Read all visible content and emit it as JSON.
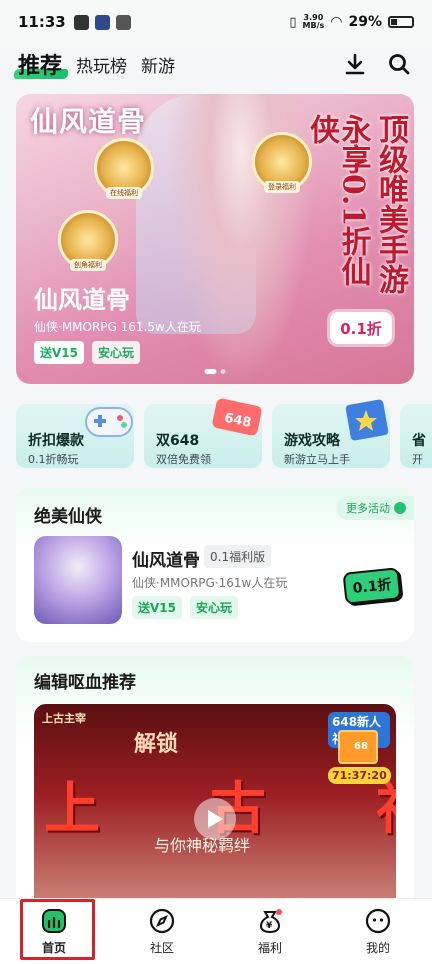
{
  "status_bar": {
    "time": "11:33",
    "net_speed_value": "3.90",
    "net_speed_unit": "MB/s",
    "battery": "29%"
  },
  "top_nav": {
    "tabs": [
      {
        "label": "推荐",
        "active": true
      },
      {
        "label": "热玩榜",
        "active": false
      },
      {
        "label": "新游",
        "active": false
      }
    ],
    "icons": [
      "download-icon",
      "search-icon"
    ]
  },
  "banner": {
    "logo_text": "仙风道骨",
    "medals": [
      "在线福利",
      "登录福利",
      "创角福利"
    ],
    "slogan_cols": [
      "顶级唯美手游",
      "永享0.1折仙侠"
    ],
    "title": "仙风道骨",
    "meta": "仙侠·MMORPG  161.5w人在玩",
    "tags": [
      "送V15",
      "安心玩"
    ],
    "discount": "0.1折"
  },
  "quick_entries": [
    {
      "title": "折扣爆款",
      "subtitle": "0.1折畅玩",
      "icon": "gamepad-icon"
    },
    {
      "title": "双648",
      "subtitle": "双倍免费领",
      "icon": "coupon-648-icon",
      "icon_text": "648"
    },
    {
      "title": "游戏攻略",
      "subtitle": "新游立马上手",
      "icon": "guide-book-icon"
    },
    {
      "title": "省",
      "subtitle": "开",
      "icon": "partial-icon"
    }
  ],
  "featured_section": {
    "title": "绝美仙侠",
    "more_label": "更多活动",
    "game": {
      "name": "仙风道骨",
      "version": "0.1福利版",
      "meta": "仙侠·MMORPG·161w人在玩",
      "tags": [
        "送V15",
        "安心玩"
      ],
      "button": "0.1折"
    }
  },
  "editor_section": {
    "title": "编辑呕血推荐",
    "video": {
      "logo": "上古主宰",
      "unlock_text": "解锁",
      "big_text": "上古神女",
      "sub_text": "与你神秘羁绊",
      "gift_label": "648新人礼",
      "gift_count": "68",
      "timer": "71:37:20"
    }
  },
  "bottom_nav": [
    {
      "label": "首页",
      "icon": "home-icon",
      "active": true
    },
    {
      "label": "社区",
      "icon": "compass-icon",
      "active": false
    },
    {
      "label": "福利",
      "icon": "money-bag-icon",
      "active": false
    },
    {
      "label": "我的",
      "icon": "profile-face-icon",
      "active": false
    }
  ],
  "colors": {
    "accent_green": "#25c06c",
    "highlight_red": "#d8222b"
  }
}
